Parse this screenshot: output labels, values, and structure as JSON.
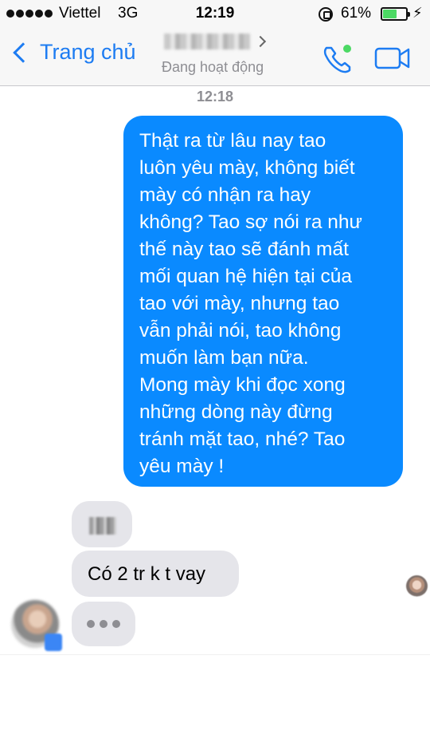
{
  "status_bar": {
    "carrier": "Viettel",
    "network": "3G",
    "time": "12:19",
    "battery_percent": "61%",
    "battery_level": 0.61,
    "icons": [
      "signal-dots-icon",
      "orientation-lock-icon",
      "battery-icon",
      "charging-icon"
    ]
  },
  "nav": {
    "back_label": "Trang chủ",
    "contact_status": "Đang hoạt động",
    "icons": [
      "back-chevron-icon",
      "phone-call-icon",
      "video-call-icon"
    ]
  },
  "chat": {
    "timestamp": "12:18",
    "outgoing_lines": [
      "Thật ra từ lâu nay tao",
      "luôn yêu mày, không biết",
      "mày có nhận ra hay",
      "không? Tao sợ nói ra như",
      "thế này tao sẽ đánh mất",
      "mối quan hệ hiện tại của",
      "tao với mày, nhưng tao",
      "vẫn phải nói, tao không",
      "muốn làm bạn nữa.",
      "Mong mày khi đọc xong",
      "những dòng này đừng",
      "tránh mặt tao, nhé? Tao",
      "yêu mày !"
    ],
    "incoming_text": "Có 2 tr k t vay"
  },
  "colors": {
    "accent": "#1d7cf2",
    "outgoing_bubble": "#0a8aff",
    "incoming_bubble": "#e5e5ea",
    "online_dot": "#4cd964"
  }
}
